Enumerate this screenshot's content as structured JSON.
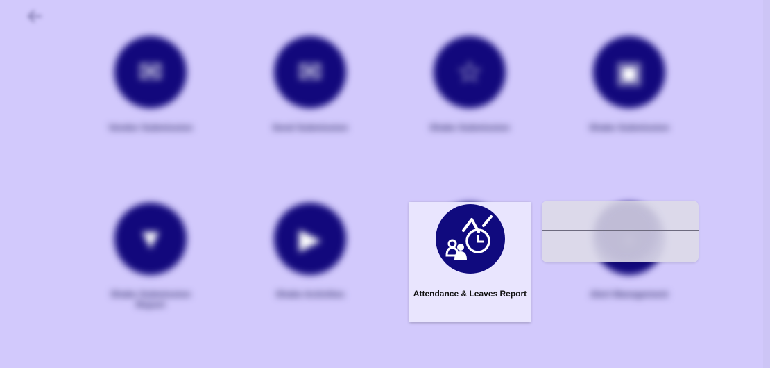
{
  "background_tiles": [
    {
      "label": "Vendor Submission",
      "icon": "inbox-icon"
    },
    {
      "label": "Send Submission",
      "icon": "mail-icon"
    },
    {
      "label": "Shake Submission",
      "icon": "handshake-icon"
    },
    {
      "label": "Shake Submission",
      "icon": "basket-icon"
    },
    {
      "label": "Shake Submission Report",
      "icon": "inbox-tray-icon"
    },
    {
      "label": "Shake Activities",
      "icon": "truck-icon"
    },
    {
      "label": "",
      "icon": "hidden-icon"
    },
    {
      "label": "Alert Management",
      "icon": "bell-icon"
    }
  ],
  "focus_card": {
    "label": "Attendance & Leaves Report",
    "icon": "attendance-report-icon"
  },
  "popup": {
    "items": [
      "",
      ""
    ]
  },
  "colors": {
    "background": "#d2c9fc",
    "icon_circle": "#12087c",
    "card": "#e9e5fe"
  }
}
